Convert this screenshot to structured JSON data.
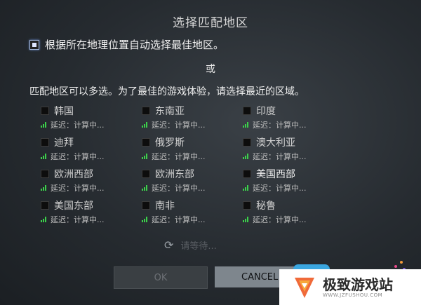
{
  "dialog": {
    "title": "选择匹配地区",
    "auto_select_label": "根据所在地理位置自动选择最佳地区。",
    "or_text": "或",
    "multi_select_text": "匹配地区可以多选。为了最佳的游戏体验，请选择最近的区域。",
    "regions": [
      {
        "name": "韩国",
        "latency": "延迟：计算中..."
      },
      {
        "name": "东南亚",
        "latency": "延迟：计算中..."
      },
      {
        "name": "印度",
        "latency": "延迟：计算中..."
      },
      {
        "name": "迪拜",
        "latency": "延迟：计算中..."
      },
      {
        "name": "俄罗斯",
        "latency": "延迟：计算中..."
      },
      {
        "name": "澳大利亚",
        "latency": "延迟：计算中..."
      },
      {
        "name": "欧洲西部",
        "latency": "延迟：计算中..."
      },
      {
        "name": "欧洲东部",
        "latency": "延迟：计算中..."
      },
      {
        "name": "美国西部",
        "latency": "延迟：计算中..."
      },
      {
        "name": "美国东部",
        "latency": "延迟：计算中..."
      },
      {
        "name": "南非",
        "latency": "延迟：计算中..."
      },
      {
        "name": "秘鲁",
        "latency": "延迟：计算中..."
      }
    ],
    "wait_text": "请等待...",
    "ok_label": "OK",
    "cancel_label": "CANCEL"
  },
  "watermark": {
    "name": "极致游戏站",
    "url": "WWW.JZFUSHOU.COM"
  }
}
